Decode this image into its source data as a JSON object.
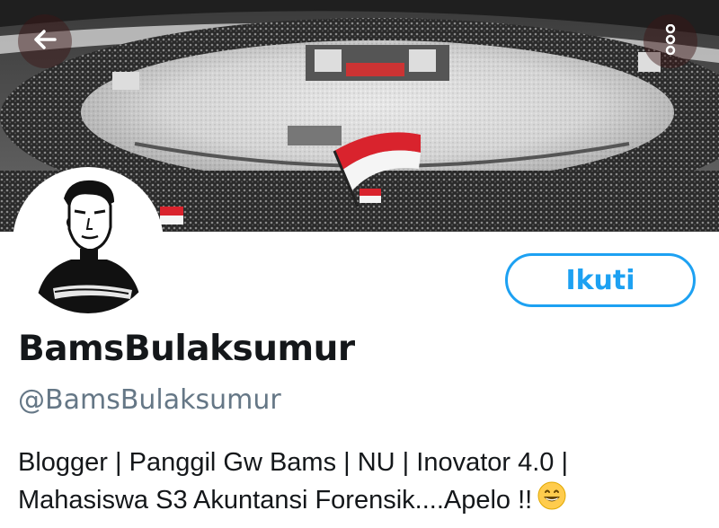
{
  "header": {
    "back_icon": "arrow-left-icon",
    "more_icon": "more-vertical-icon",
    "banner_image": "stadium-crowd-banner"
  },
  "profile": {
    "avatar_image": "profile-avatar-sketch",
    "follow_label": "Ikuti",
    "display_name": "BamsBulaksumur",
    "handle": "@BamsBulaksumur",
    "bio_line_1": "Blogger | Panggil Gw Bams | NU | Inovator 4.0 |",
    "bio_line_2": "Mahasiswa S3 Akuntansi Forensik....Apelo !!",
    "bio_emoji": "grinning-face-icon"
  },
  "colors": {
    "accent": "#1da1f2",
    "name": "#14171a",
    "handle": "#657786"
  }
}
